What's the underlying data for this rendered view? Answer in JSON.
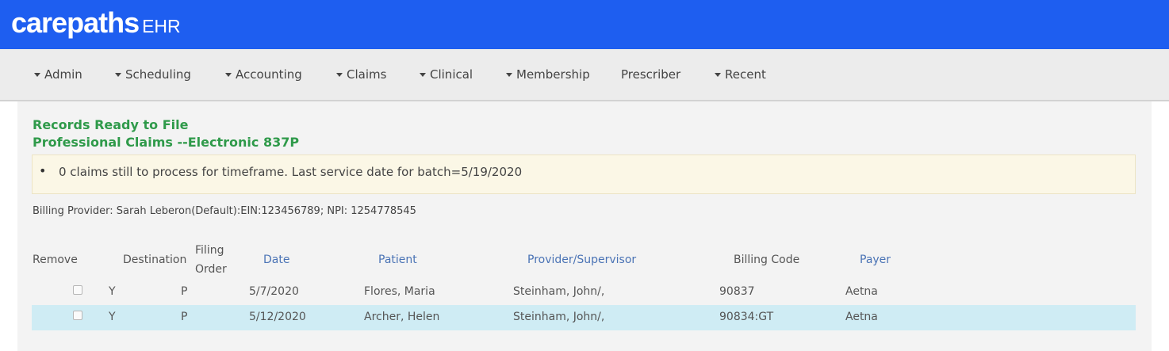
{
  "header": {
    "brand": "carepaths",
    "sub": "EHR"
  },
  "nav": {
    "items": [
      {
        "label": "Admin",
        "dropdown": true
      },
      {
        "label": "Scheduling",
        "dropdown": true
      },
      {
        "label": "Accounting",
        "dropdown": true
      },
      {
        "label": "Claims",
        "dropdown": true
      },
      {
        "label": "Clinical",
        "dropdown": true
      },
      {
        "label": "Membership",
        "dropdown": true
      },
      {
        "label": "Prescriber",
        "dropdown": false
      },
      {
        "label": "Recent",
        "dropdown": true
      }
    ]
  },
  "page": {
    "title": "Records Ready to File",
    "subtitle": "Professional Claims --Electronic 837P",
    "notice": "0 claims still to process for timeframe. Last service date for batch=5/19/2020",
    "billing_provider": "Billing Provider: Sarah Leberon(Default):EIN:123456789; NPI: 1254778545"
  },
  "table": {
    "headers": {
      "remove": "Remove",
      "destination": "Destination",
      "filing_order": "Filing Order",
      "date": "Date",
      "patient": "Patient",
      "provider": "Provider/Supervisor",
      "billing_code": "Billing Code",
      "payer": "Payer"
    },
    "rows": [
      {
        "destination": "Y",
        "filing_order": "P",
        "date": "5/7/2020",
        "patient": "Flores, Maria",
        "provider": "Steinham, John/,",
        "billing_code": "90837",
        "payer": "Aetna",
        "selected": false
      },
      {
        "destination": "Y",
        "filing_order": "P",
        "date": "5/12/2020",
        "patient": "Archer, Helen",
        "provider": "Steinham, John/,",
        "billing_code": "90834:GT",
        "payer": "Aetna",
        "selected": true
      }
    ]
  },
  "colors": {
    "header_bg": "#1e5ef0",
    "title_green": "#2f9a4a",
    "link_blue": "#4a73b5",
    "selected_row": "#cfecf4"
  }
}
